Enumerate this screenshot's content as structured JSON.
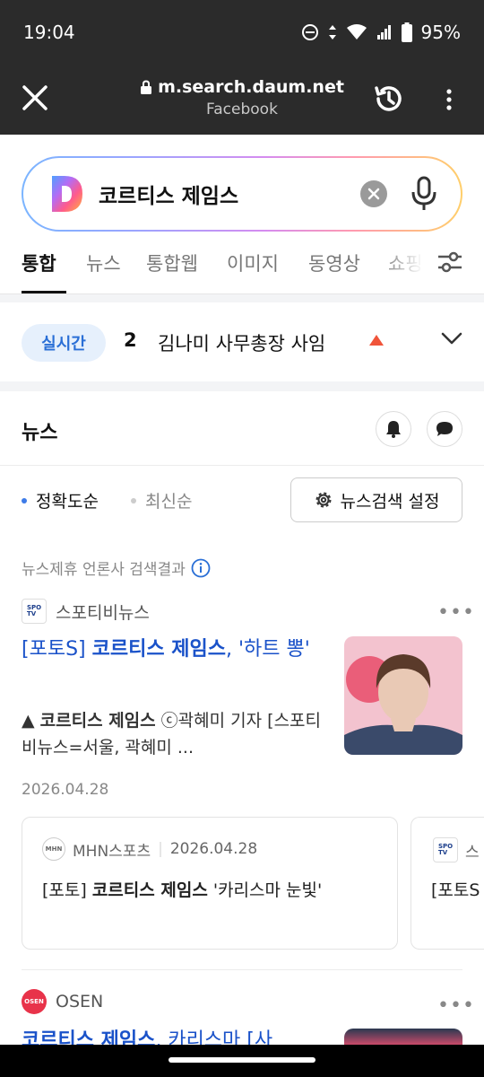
{
  "status": {
    "time": "19:04",
    "battery": "95%"
  },
  "browser": {
    "domain": "m.search.daum.net",
    "subtitle": "Facebook"
  },
  "search": {
    "query": "코르티스 제임스"
  },
  "tabs": [
    {
      "label": "통합",
      "active": true
    },
    {
      "label": "뉴스",
      "active": false
    },
    {
      "label": "통합웹",
      "active": false
    },
    {
      "label": "이미지",
      "active": false
    },
    {
      "label": "동영상",
      "active": false
    },
    {
      "label": "쇼핑",
      "active": false
    }
  ],
  "realtime": {
    "badge": "실시간",
    "rank": "2",
    "text": "김나미 사무총장 사임"
  },
  "news": {
    "title": "뉴스",
    "sort_accuracy": "정확도순",
    "sort_latest": "최신순",
    "settings_label": "뉴스검색 설정",
    "affiliate_note": "뉴스제휴 언론사 검색결과",
    "article1": {
      "source": "스포티비뉴스",
      "title_prefix": "[포토S] ",
      "title_bold": "코르티스 제임스",
      "title_suffix": ", '하트 뽕'",
      "snippet_bold": "코르티스 제임스",
      "snippet_rest": " ⓒ곽혜미 기자 [스포티비뉴스=서울, 곽혜미 ...",
      "snippet_mark": "▲ ",
      "date": "2026.04.28"
    },
    "subcard1": {
      "source": "MHN스포츠",
      "date": "2026.04.28",
      "title_prefix": "[포토] ",
      "title_bold": "코르티스 제임스",
      "title_suffix": " '카리스마 눈빛'"
    },
    "subcard2": {
      "source": "스",
      "title_prefix": "[포토S"
    },
    "article2": {
      "source": "OSEN",
      "title_bold": "코르티스 제임스",
      "title_suffix": ", 카리스마 [사"
    }
  },
  "colors": {
    "link": "#1a52c9",
    "accent_blue": "#2a6fd6",
    "up_arrow": "#f0543a"
  }
}
